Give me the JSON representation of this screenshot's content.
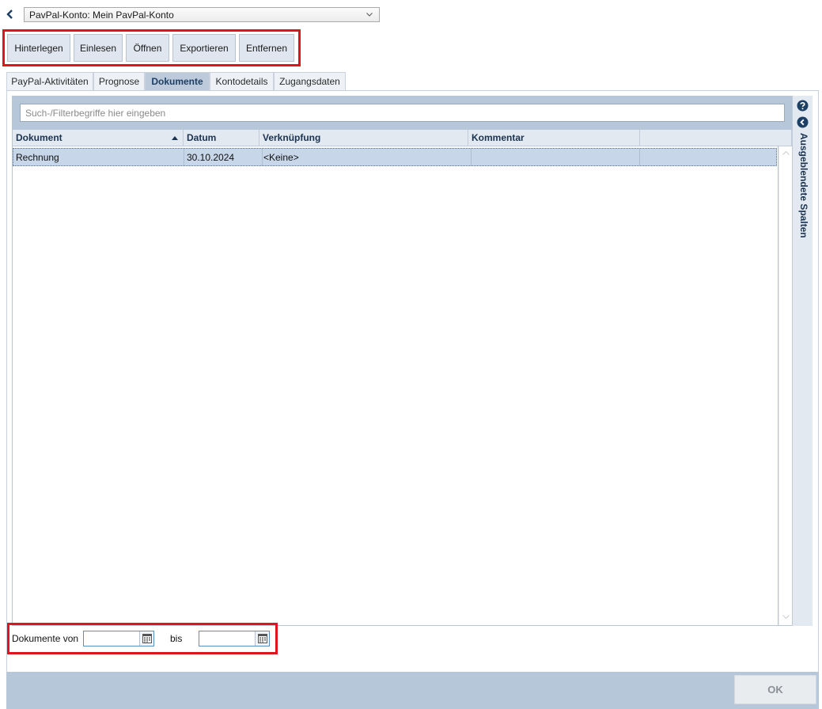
{
  "header": {
    "account_selector": {
      "value": "PavPal-Konto: Mein PavPal-Konto"
    }
  },
  "toolbar": {
    "buttons": [
      {
        "label": "Hinterlegen"
      },
      {
        "label": "Einlesen"
      },
      {
        "label": "Öffnen"
      },
      {
        "label": "Exportieren"
      },
      {
        "label": "Entfernen"
      }
    ]
  },
  "tabs": [
    {
      "label": "PayPal-Aktivitäten",
      "active": false
    },
    {
      "label": "Prognose",
      "active": false
    },
    {
      "label": "Dokumente",
      "active": true
    },
    {
      "label": "Kontodetails",
      "active": false
    },
    {
      "label": "Zugangsdaten",
      "active": false
    }
  ],
  "search": {
    "placeholder": "Such-/Filterbegriffe hier eingeben",
    "value": ""
  },
  "table": {
    "columns": [
      {
        "label": "Dokument",
        "sorted": "ascending"
      },
      {
        "label": "Datum"
      },
      {
        "label": "Verknüpfung"
      },
      {
        "label": "Kommentar"
      }
    ],
    "rows": [
      {
        "dokument": "Rechnung",
        "datum": "30.10.2024",
        "verknuepfung": "<Keine>",
        "kommentar": "",
        "selected": true
      }
    ]
  },
  "side_panel": {
    "hidden_columns_label": "Ausgeblendete Spalten"
  },
  "date_range": {
    "from_label": "Dokumente von",
    "from_value": "",
    "to_label": "bis",
    "to_value": ""
  },
  "footer": {
    "ok_label": "OK",
    "ok_enabled": false
  },
  "colors": {
    "accent": "#1d3f63",
    "highlight_box": "#e0141b",
    "grid_frame": "#b7c7da",
    "selected_row": "#c7d6e8"
  },
  "icons": [
    "back-chevron-icon",
    "chevron-down-icon",
    "sort-ascending-icon",
    "help-icon",
    "collapse-left-icon",
    "calendar-icon",
    "scroll-up-icon",
    "scroll-down-icon"
  ]
}
